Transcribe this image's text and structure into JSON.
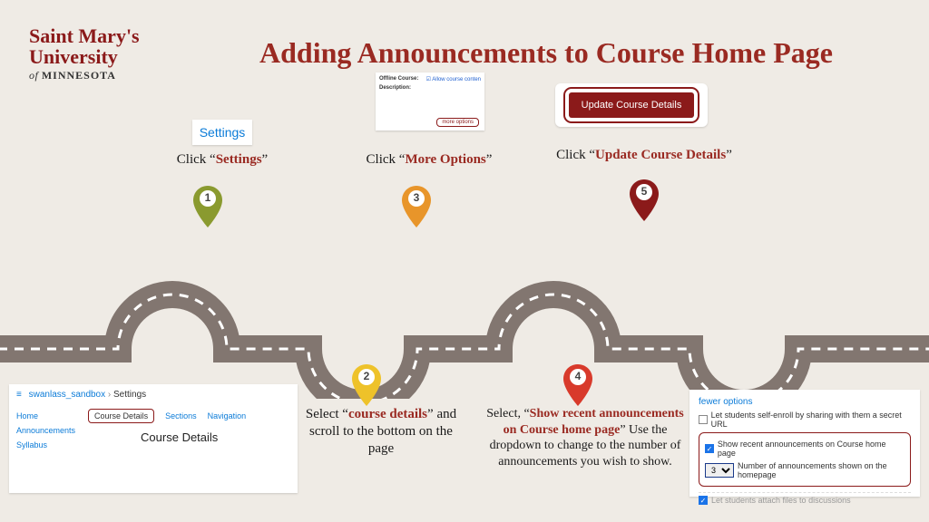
{
  "logo": {
    "line1": "Saint Mary's",
    "line2": "University",
    "of": "of",
    "state": "MINNESOTA"
  },
  "title": "Adding Announcements to Course Home Page",
  "pins": {
    "p1": {
      "num": "1",
      "color": "#8a9a2f"
    },
    "p2": {
      "num": "2",
      "color": "#eec22a"
    },
    "p3": {
      "num": "3",
      "color": "#e8952a"
    },
    "p4": {
      "num": "4",
      "color": "#d83a2b"
    },
    "p5": {
      "num": "5",
      "color": "#8b1a1a"
    }
  },
  "step1": {
    "settings_label": "Settings",
    "caption_prefix": "Click “",
    "caption_em": "Settings",
    "caption_suffix": "”"
  },
  "step2": {
    "breadcrumb_root": "swanlass_sandbox",
    "breadcrumb_sep": " › ",
    "breadcrumb_current": "Settings",
    "nav": {
      "home": "Home",
      "announcements": "Announcements",
      "syllabus": "Syllabus"
    },
    "tabs": {
      "course_details": "Course Details",
      "sections": "Sections",
      "navigation": "Navigation"
    },
    "heading": "Course Details",
    "caption_prefix": "Select “",
    "caption_em": "course details",
    "caption_suffix": "” and scroll to the bottom on the page"
  },
  "step3": {
    "offline_label": "Offline Course:",
    "offline_check_label": "Allow course conten",
    "description_label": "Description:",
    "more_options": "more options",
    "caption_prefix": "Click “",
    "caption_em": "More Options",
    "caption_suffix": "”"
  },
  "step4": {
    "fewer": "fewer options",
    "self_enroll": "Let students self-enroll by sharing with them a secret URL",
    "show_recent": "Show recent announcements on Course home page",
    "dropdown_value": "3",
    "dropdown_caption": "Number of announcements shown on the homepage",
    "attach_cut": "Let students attach files to discussions",
    "caption_prefix": "Select, “",
    "caption_em": "Show recent announcements on Course home page",
    "caption_suffix": "” Use the dropdown to change to the number of announcements you wish to show."
  },
  "step5": {
    "button": "Update Course Details",
    "caption_prefix": "Click “",
    "caption_em": "Update Course Details",
    "caption_suffix": "”"
  }
}
